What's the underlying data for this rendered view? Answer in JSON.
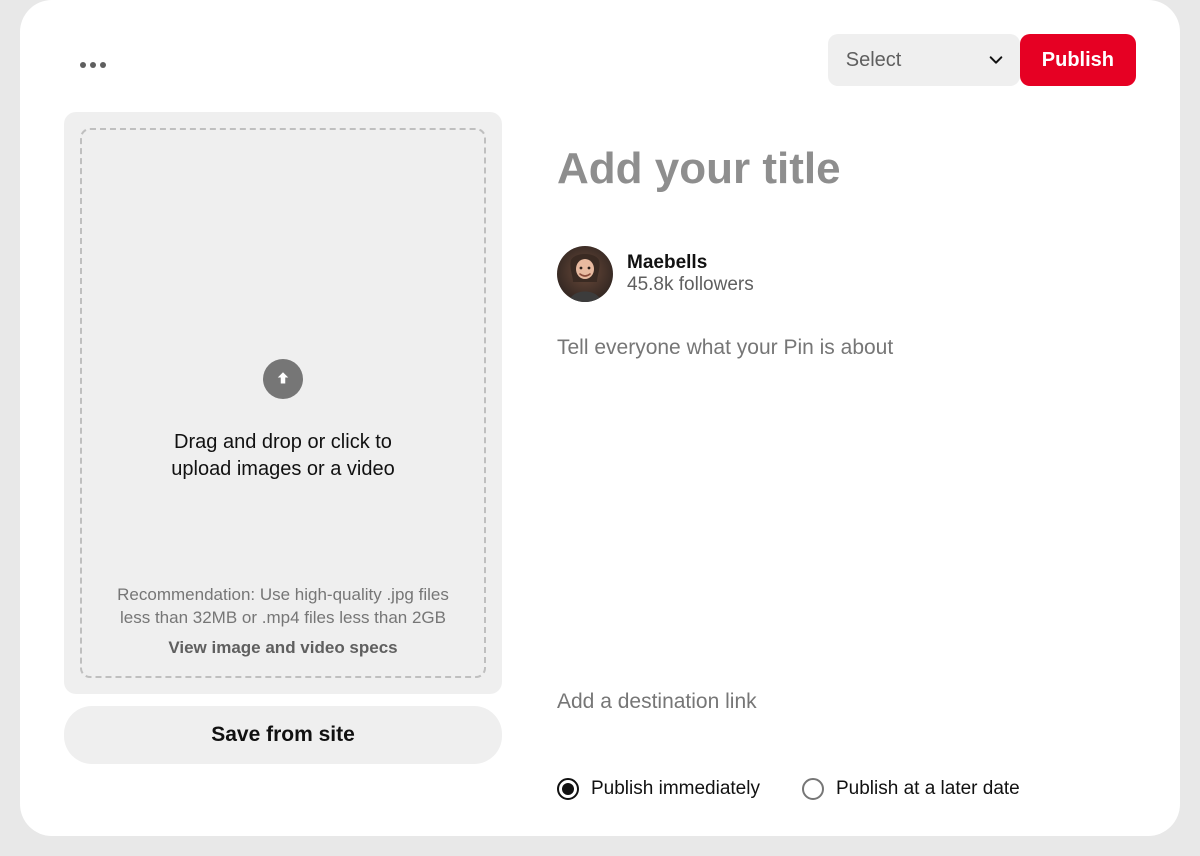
{
  "header": {
    "board_select_label": "Select",
    "publish_label": "Publish"
  },
  "upload": {
    "prompt": "Drag and drop or click to upload images or a video",
    "recommendation": "Recommendation: Use high-quality .jpg files less than 32MB or .mp4 files less than 2GB",
    "specs_link": "View image and video specs"
  },
  "save_from_site_label": "Save from site",
  "form": {
    "title_placeholder": "Add your title",
    "description_placeholder": "Tell everyone what your Pin is about",
    "destination_link_placeholder": "Add a destination link"
  },
  "user": {
    "name": "Maebells",
    "followers": "45.8k followers"
  },
  "schedule": {
    "immediate_label": "Publish immediately",
    "later_label": "Publish at a later date",
    "selected": "immediate"
  },
  "colors": {
    "accent": "#e60023"
  }
}
